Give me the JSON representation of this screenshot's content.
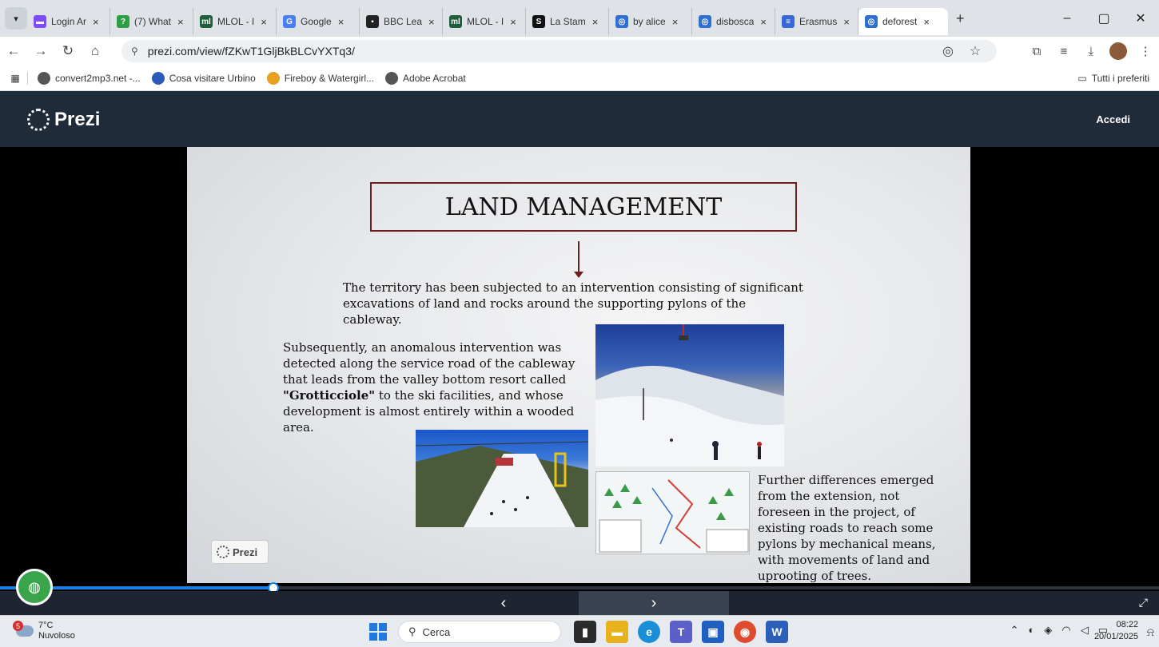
{
  "browser": {
    "tabs": [
      {
        "title": "Login Ar",
        "color": "#7c4dff",
        "glyph": "▬"
      },
      {
        "title": "(7) What",
        "color": "#2e9e44",
        "glyph": "?"
      },
      {
        "title": "MLOL - I",
        "color": "#1f5e3a",
        "glyph": "ml"
      },
      {
        "title": "Google",
        "color": "#4a7ef5",
        "glyph": "G"
      },
      {
        "title": "BBC Lea",
        "color": "#222",
        "glyph": "▪"
      },
      {
        "title": "MLOL - I",
        "color": "#1f5e3a",
        "glyph": "ml"
      },
      {
        "title": "La Stam",
        "color": "#111",
        "glyph": "S"
      },
      {
        "title": "by alice",
        "color": "#2f6fd1",
        "glyph": "◎"
      },
      {
        "title": "disbosca",
        "color": "#2f6fd1",
        "glyph": "◎"
      },
      {
        "title": "Erasmus",
        "color": "#3867d6",
        "glyph": "≡"
      },
      {
        "title": "deforest",
        "color": "#2f6fd1",
        "glyph": "◎"
      }
    ],
    "tab_close": "×",
    "new_tab": "+",
    "win_min": "–",
    "win_max": "▢",
    "win_close": "✕",
    "url": "prezi.com/view/fZKwT1GljBkBLCvYXTq3/",
    "bookmarks": [
      {
        "label": "convert2mp3.net -...",
        "color": "#555"
      },
      {
        "label": "Cosa visitare Urbino",
        "color": "#2a5bb8"
      },
      {
        "label": "Fireboy & Watergirl...",
        "color": "#e8a021"
      },
      {
        "label": "Adobe Acrobat",
        "color": "#555"
      }
    ],
    "all_bookmarks": "Tutti i preferiti"
  },
  "prezi": {
    "brand": "Prezi",
    "login": "Accedi",
    "badge": "Prezi"
  },
  "slide": {
    "title": "LAND MANAGEMENT",
    "para1": "The territory has been subjected to an intervention consisting of significant excavations of land and rocks around the supporting pylons of the cableway.",
    "para2_before": "Subsequently, an anomalous intervention was detected along the service road of the cableway that leads from the valley bottom resort called ",
    "para2_bold": "\"Grotticciole\"",
    "para2_after": " to the ski facilities, and whose development is almost entirely within a wooded area.",
    "para3": "Further differences emerged from the extension, not foreseen in the project, of existing roads to reach some pylons by mechanical means, with movements of land and uprooting of trees."
  },
  "player": {
    "progress_fraction": 0.236,
    "prev": "‹",
    "next": "›",
    "fullscreen": "⤢"
  },
  "taskbar": {
    "temperature": "7°C",
    "weather": "Nuvoloso",
    "notifications": "5",
    "search": "Cerca",
    "time": "08:22",
    "date": "20/01/2025"
  }
}
